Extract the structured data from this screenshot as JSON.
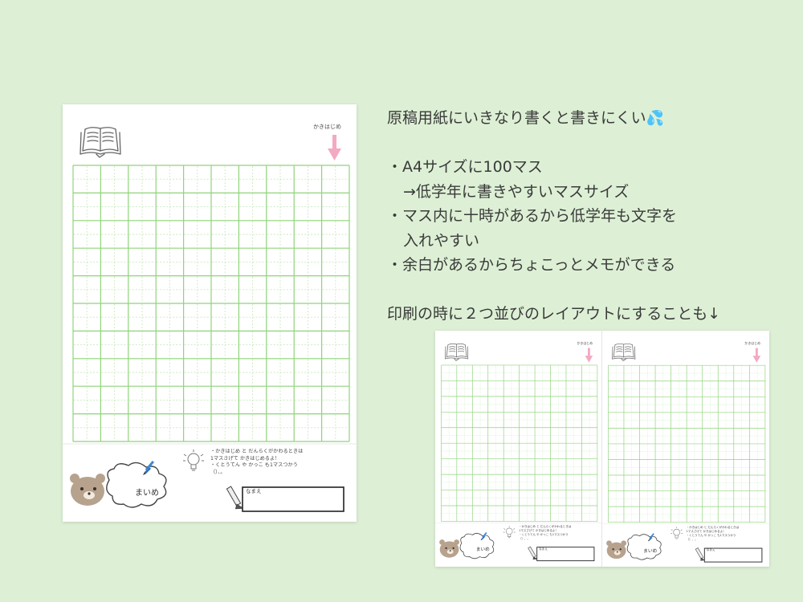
{
  "sheet": {
    "start_label": "かきはじめ",
    "instructions": [
      "・かきはじめ と だんらくがかわるときは",
      "1マスさげて かきはじめるよ！",
      "・くとうてん や かっこ も1マスつかう",
      "（）、。"
    ],
    "brand": "まいめ",
    "name_label": "なまえ",
    "colors": {
      "grid_line": "#8fd47a",
      "dash_line": "#c9e9bd",
      "arrow": "#f4a9c2",
      "bear": "#b7a28e"
    },
    "icons": [
      "open-book-icon",
      "down-arrow-icon",
      "lightbulb-icon",
      "bear-icon",
      "pencil-icon"
    ]
  },
  "description": {
    "title": "原稿用紙にいきなり書くと書きにくい",
    "title_emoji": "💦",
    "bullet1": "・A4サイズに100マス",
    "bullet1_sub": "→低学年に書きやすいマスサイズ",
    "bullet2": "・マス内に十時があるから低学年も文字を",
    "bullet2_cont": "入れやすい",
    "bullet3": "・余白があるからちょこっとメモができる",
    "print_note": "印刷の時に２つ並びのレイアウトにすることも↓"
  }
}
